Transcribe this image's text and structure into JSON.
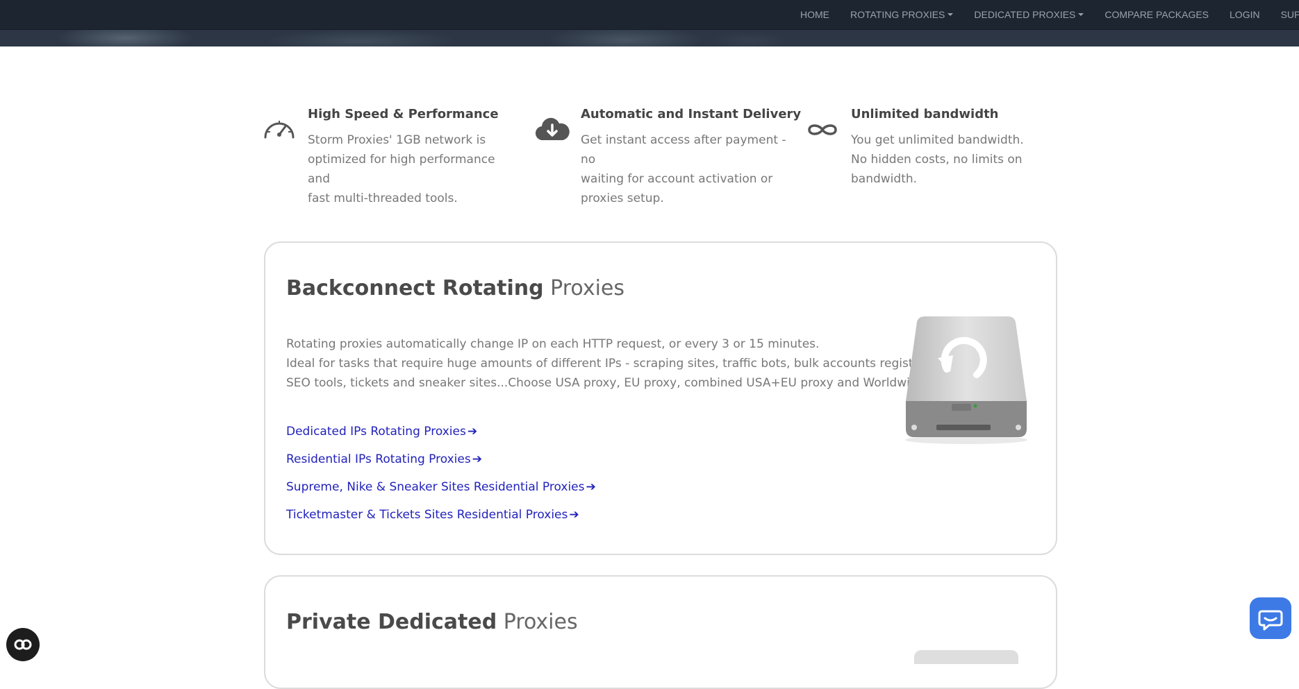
{
  "nav": {
    "items": [
      {
        "label": "HOME",
        "dropdown": false
      },
      {
        "label": "ROTATING PROXIES",
        "dropdown": true
      },
      {
        "label": "DEDICATED PROXIES",
        "dropdown": true
      },
      {
        "label": "COMPARE PACKAGES",
        "dropdown": false
      },
      {
        "label": "LOGIN",
        "dropdown": false
      },
      {
        "label": "SUPPORT",
        "dropdown": false
      }
    ]
  },
  "features": [
    {
      "icon": "speedometer-icon",
      "title": "High Speed & Performance",
      "lines": [
        "Storm Proxies' 1GB network is",
        "optimized for high performance and",
        "fast multi-threaded tools."
      ]
    },
    {
      "icon": "cloud-download-icon",
      "title": "Automatic and Instant Delivery",
      "lines": [
        "Get instant access after payment - no",
        "waiting for account activation or",
        "proxies setup."
      ]
    },
    {
      "icon": "infinity-icon",
      "title": "Unlimited bandwidth",
      "lines": [
        "You get unlimited bandwidth.",
        "No hidden costs, no limits on",
        "bandwidth."
      ]
    }
  ],
  "rotating_card": {
    "title_bold": "Backconnect Rotating",
    "title_light": "Proxies",
    "desc_lines": [
      "Rotating proxies automatically change IP on each HTTP request, or every 3 or 15 minutes.",
      "Ideal for tasks that require huge amounts of different IPs - scraping sites, traffic bots, bulk accounts registration,",
      "SEO tools, tickets and sneaker sites...Choose USA proxy, EU proxy, combined USA+EU proxy and Worldwide proxy"
    ],
    "links": [
      "Dedicated IPs Rotating Proxies",
      "Residential IPs Rotating Proxies",
      "Supreme, Nike & Sneaker Sites Residential Proxies",
      "Ticketmaster & Tickets Sites Residential Proxies"
    ],
    "arrow": "➔",
    "image_icon": "rotating-drive-icon"
  },
  "dedicated_card": {
    "title_bold": "Private Dedicated",
    "title_light": "Proxies"
  },
  "widgets": {
    "chat_icon": "chat-bubble-icon",
    "cookie_icon": "cookie-settings-icon"
  },
  "colors": {
    "navbar_bg": "#1d2530",
    "link": "#2222bb",
    "chat_button": "#3d7ae6"
  }
}
